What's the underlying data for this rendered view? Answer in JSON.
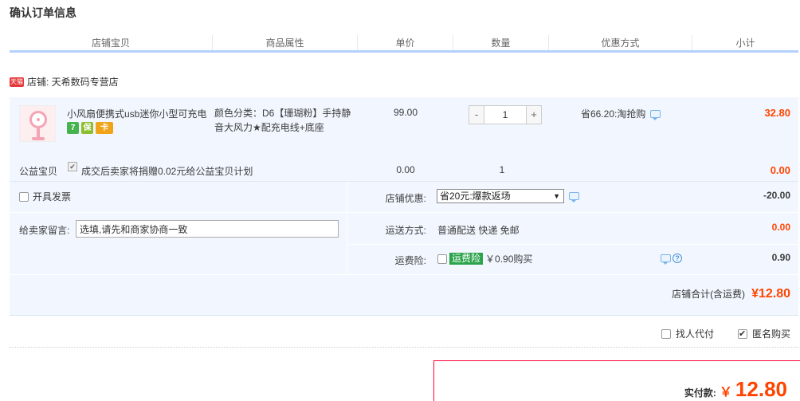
{
  "page_title": "确认订单信息",
  "columns": [
    "店铺宝贝",
    "商品属性",
    "单价",
    "数量",
    "优惠方式",
    "小计"
  ],
  "shop": {
    "badge": "天猫",
    "label": "店铺: 天希数码专营店"
  },
  "item": {
    "name": "小风扇便携式usb迷你小型可充电",
    "attributes": "颜色分类：D6【珊瑚粉】手持静音大风力★配充电线+底座",
    "price": "99.00",
    "quantity": "1",
    "qty_minus": "-",
    "qty_plus": "+",
    "discount": "省66.20:淘抢购",
    "subtotal": "32.80",
    "icons": [
      "7",
      "保",
      "卡"
    ]
  },
  "welfare": {
    "label": "公益宝贝",
    "desc": "成交后卖家将捐赠0.02元给公益宝贝计划",
    "price": "0.00",
    "quantity": "1",
    "subtotal": "0.00"
  },
  "invoice": {
    "label": "开具发票"
  },
  "message": {
    "label": "给卖家留言:",
    "placeholder": "选填,请先和商家协商一致"
  },
  "shop_discount": {
    "label": "店铺优惠:",
    "selected": "省20元:爆款返场",
    "amount": "-20.00"
  },
  "shipping": {
    "label": "运送方式:",
    "value": "普通配送 快递 免邮",
    "amount": "0.00"
  },
  "insurance": {
    "label": "运费险:",
    "badge": "运费险",
    "price_text": "￥0.90购买",
    "amount": "0.90"
  },
  "shop_total": {
    "label": "店铺合计(含运费)",
    "amount": "¥12.80"
  },
  "extra": {
    "proxy_label": "找人代付",
    "anonymous_label": "匿名购买"
  },
  "payment": {
    "label": "实付款:",
    "currency": "￥",
    "amount": "12.80"
  },
  "colors": {
    "accent": "#ff4400",
    "header_border": "#b2d1ff",
    "row_bg": "#f2f7ff",
    "insurance_green": "#2aa34a"
  }
}
